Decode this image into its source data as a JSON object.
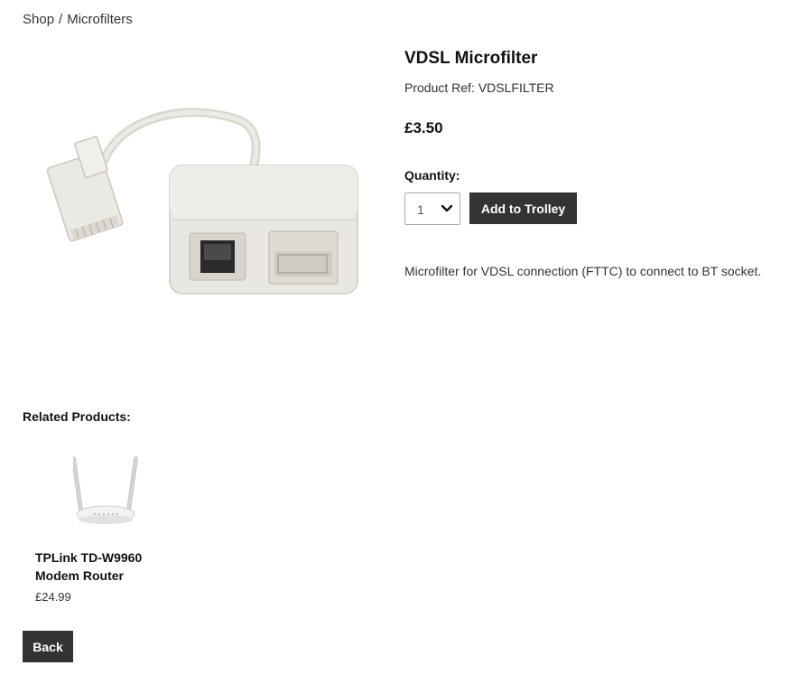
{
  "breadcrumb": {
    "shop": "Shop",
    "separator": "/",
    "category": "Microfilters"
  },
  "product": {
    "title": "VDSL Microfilter",
    "ref_label": "Product Ref:",
    "ref": "VDSLFILTER",
    "price": "£3.50",
    "quantity_label": "Quantity:",
    "quantity_value": "1",
    "add_button": "Add to Trolley",
    "description": "Microfilter for VDSL connection (FTTC) to connect to BT socket."
  },
  "related": {
    "heading": "Related Products:",
    "items": [
      {
        "name": "TPLink TD-W9960 Modem Router",
        "price": "£24.99"
      }
    ]
  },
  "back_button": "Back",
  "colors": {
    "button_bg": "#333333",
    "button_text": "#ffffff",
    "text": "#222222"
  },
  "icons": {
    "quantity_dropdown": "chevron-down-icon"
  }
}
